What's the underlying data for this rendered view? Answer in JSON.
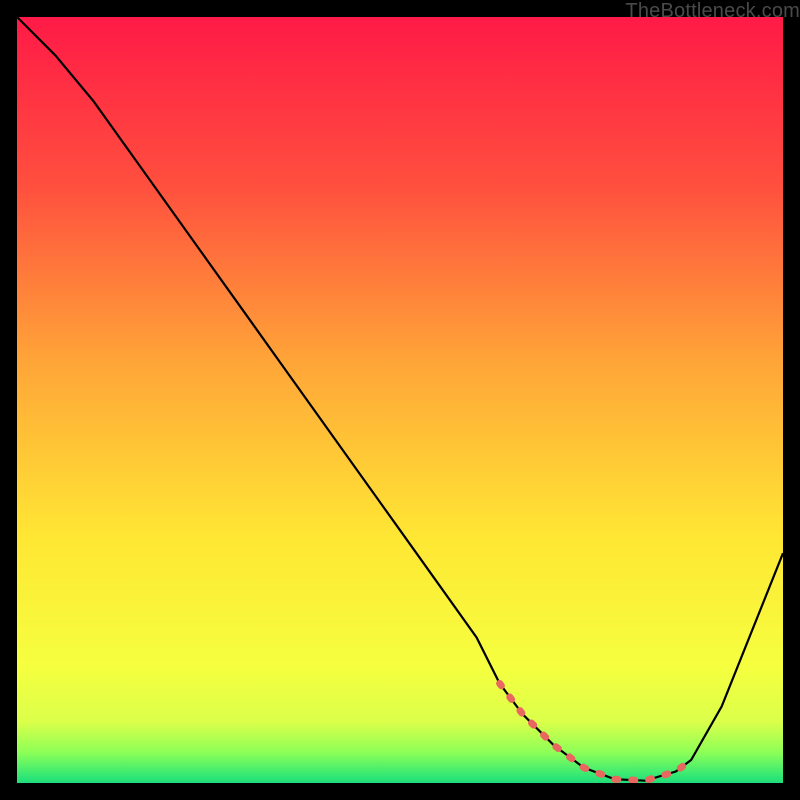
{
  "watermark": "TheBottleneck.com",
  "chart_data": {
    "type": "line",
    "title": "",
    "xlabel": "",
    "ylabel": "",
    "xlim": [
      0,
      100
    ],
    "ylim": [
      0,
      100
    ],
    "grid": false,
    "series": [
      {
        "name": "bottleneck-curve",
        "x": [
          0,
          5,
          10,
          15,
          20,
          25,
          30,
          35,
          40,
          45,
          50,
          55,
          60,
          63,
          66,
          70,
          74,
          78,
          82,
          86,
          88,
          92,
          100
        ],
        "values": [
          100,
          95,
          89,
          82,
          75,
          68,
          61,
          54,
          47,
          40,
          33,
          26,
          19,
          13,
          9,
          5,
          2,
          0.5,
          0.3,
          1.5,
          3,
          10,
          30
        ]
      },
      {
        "name": "optimal-range-marker",
        "x": [
          63,
          66,
          70,
          74,
          78,
          82,
          86,
          88
        ],
        "values": [
          13,
          9,
          5,
          2,
          0.5,
          0.3,
          1.5,
          3
        ]
      }
    ],
    "gradient_stops": [
      {
        "pct": 0,
        "color": "#ff1a47"
      },
      {
        "pct": 22,
        "color": "#ff4f3e"
      },
      {
        "pct": 45,
        "color": "#ffa538"
      },
      {
        "pct": 68,
        "color": "#ffe734"
      },
      {
        "pct": 85,
        "color": "#f5ff3f"
      },
      {
        "pct": 92,
        "color": "#dbff4a"
      },
      {
        "pct": 96,
        "color": "#8dff57"
      },
      {
        "pct": 99,
        "color": "#35e874"
      },
      {
        "pct": 100,
        "color": "#1edc7a"
      }
    ],
    "marker_color": "#e8675f"
  }
}
